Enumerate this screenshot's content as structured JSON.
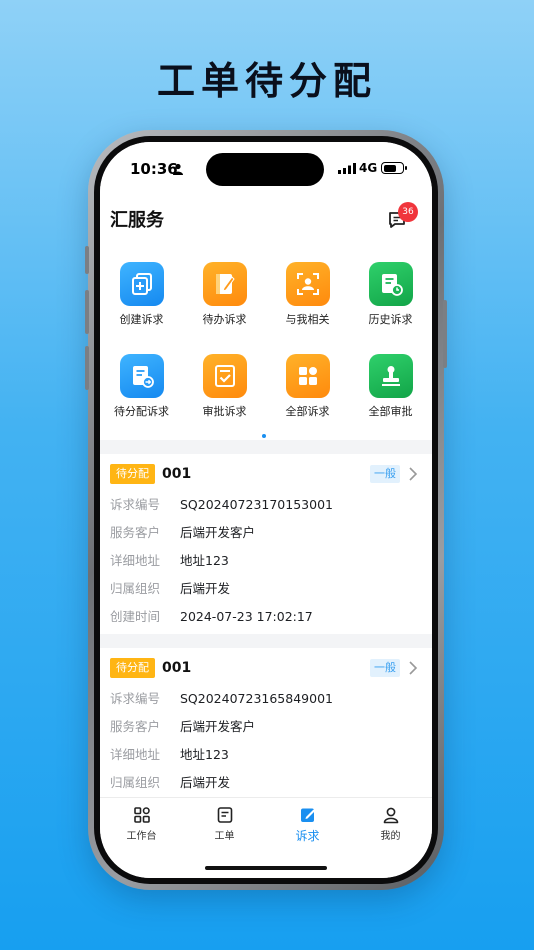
{
  "promo": {
    "headline": "工单待分配"
  },
  "status_bar": {
    "time": "10:36",
    "network": "4G"
  },
  "header": {
    "title": "汇服务",
    "message_count": "36"
  },
  "quick_menu": [
    {
      "label": "创建诉求",
      "icon": "create-ticket-icon",
      "color": "blue"
    },
    {
      "label": "待办诉求",
      "icon": "todo-notebook-icon",
      "color": "orange"
    },
    {
      "label": "与我相关",
      "icon": "person-scan-icon",
      "color": "orange"
    },
    {
      "label": "历史诉求",
      "icon": "history-clock-icon",
      "color": "green"
    },
    {
      "label": "待分配诉求",
      "icon": "assign-ticket-icon",
      "color": "blue"
    },
    {
      "label": "审批诉求",
      "icon": "approve-check-icon",
      "color": "orange"
    },
    {
      "label": "全部诉求",
      "icon": "grid-squares-icon",
      "color": "orange"
    },
    {
      "label": "全部审批",
      "icon": "stamp-icon",
      "color": "green"
    }
  ],
  "tickets": [
    {
      "status": "待分配",
      "order_no": "001",
      "level": "一般",
      "fields": [
        {
          "label": "诉求编号",
          "value": "SQ20240723170153001"
        },
        {
          "label": "服务客户",
          "value": "后端开发客户"
        },
        {
          "label": "详细地址",
          "value": "地址123"
        },
        {
          "label": "归属组织",
          "value": "后端开发"
        },
        {
          "label": "创建时间",
          "value": "2024-07-23 17:02:17"
        }
      ]
    },
    {
      "status": "待分配",
      "order_no": "001",
      "level": "一般",
      "fields": [
        {
          "label": "诉求编号",
          "value": "SQ20240723165849001"
        },
        {
          "label": "服务客户",
          "value": "后端开发客户"
        },
        {
          "label": "详细地址",
          "value": "地址123"
        },
        {
          "label": "归属组织",
          "value": "后端开发"
        }
      ]
    }
  ],
  "tab_bar": [
    {
      "label": "工作台",
      "icon": "workbench-grid-icon",
      "active": false
    },
    {
      "label": "工单",
      "icon": "work-order-icon",
      "active": false
    },
    {
      "label": "诉求",
      "icon": "appeal-edit-icon",
      "active": true
    },
    {
      "label": "我的",
      "icon": "profile-icon",
      "active": false
    }
  ],
  "colors": {
    "accent": "#1a8ff0",
    "pending_badge": "#ffb514",
    "notification_badge": "#f0353c"
  }
}
